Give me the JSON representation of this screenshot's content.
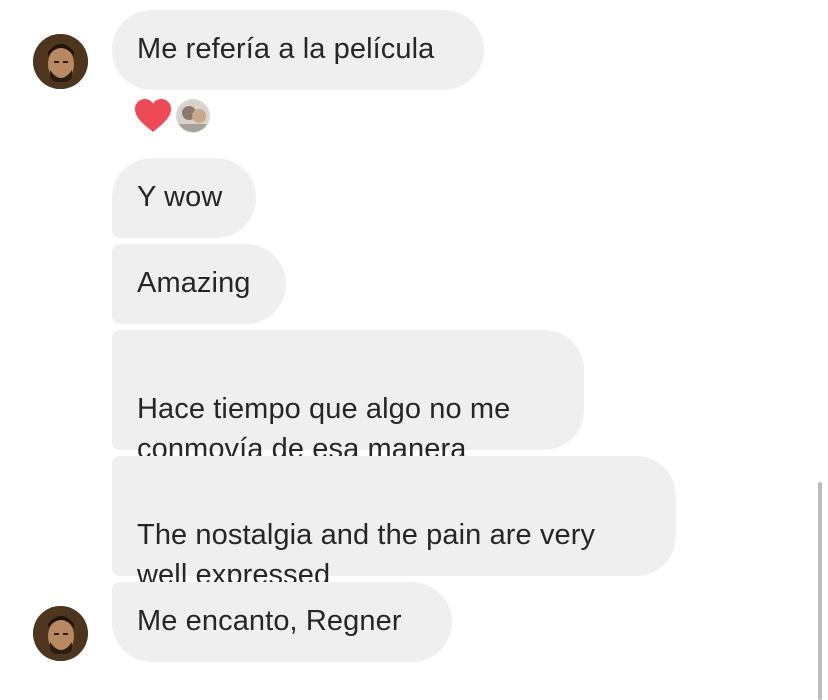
{
  "conversation": {
    "messages": [
      {
        "text": "Me refería a la película",
        "reactions": [
          "heart-reaction"
        ]
      },
      {
        "text": "Y wow"
      },
      {
        "text": "Amazing"
      },
      {
        "text": "Hace tiempo que algo no me\nconmovía de esa manera"
      },
      {
        "text": "The nostalgia and the pain are very\nwell expressed"
      },
      {
        "text": "Me encanto, Regner"
      }
    ]
  },
  "colors": {
    "bubble_bg": "#efefef",
    "text": "#262626",
    "heart": "#ed4956"
  },
  "icons": {
    "reaction": "heart-icon",
    "sender_avatar": "avatar",
    "reactor_avatar": "avatar"
  }
}
